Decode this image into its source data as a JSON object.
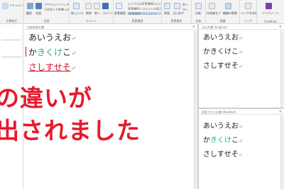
{
  "ribbon": {
    "groups": [
      {
        "label": "文章校正"
      },
      {
        "label": "言語"
      },
      {
        "label": "コメント"
      },
      {
        "label": "変更履歴"
      },
      {
        "label": "変更箇所"
      },
      {
        "label": "比較"
      },
      {
        "label": "保護"
      },
      {
        "label": "インク"
      },
      {
        "label": "OneNote"
      }
    ],
    "buttons": {
      "group1": "ドキュメント検査",
      "translate": "翻訳",
      "language": "言語",
      "new_comment": "新しいコメント",
      "delete": "削除",
      "comment_prev": "前へ",
      "comment_next": "次へ",
      "show_comments": "コメントの表示",
      "track_changes": "変更履歴の記録",
      "simple_markup": "シンプルな変更履歴/コメント",
      "show_markup": "変更履歴とコメントの表示",
      "reviewing_pane": "[変更履歴] ウィンドウ",
      "accept": "承諾",
      "reject": "元に戻す",
      "change_prev": "前へ",
      "change_next": "次へ",
      "compare": "比較",
      "block_authors": "作成者をブロック",
      "restrict_editing": "編集の制限",
      "hide_ink": "インクを非表示",
      "linked_notes": "リンクノート",
      "accessibility": "アクセシビリティチェック",
      "japanese_conversion": "日本語入力辞書への単語登録"
    }
  },
  "compared_pane": {
    "header": "比較結果文書",
    "lines": [
      {
        "text": "あいうえお",
        "mark": "↵"
      },
      {
        "pre": "か",
        "green": "きくけ",
        "post": "こ",
        "mark": "↵"
      },
      {
        "red": "さしすせそ",
        "mark": "↵"
      }
    ]
  },
  "original_pane": {
    "header": "元の文書 (Original)",
    "lines": [
      {
        "text": "あいうえお",
        "mark": "↵"
      },
      {
        "text": "かきくけこ",
        "mark": "↵"
      },
      {
        "text": "さしすせそ",
        "mark": "↵"
      }
    ]
  },
  "revised_pane": {
    "header": "変更された文書 (Modifed)",
    "lines": [
      {
        "text": "あいうえお",
        "mark": "↵"
      },
      {
        "pre": "か",
        "green": "きくけ",
        "post": "こ",
        "mark": "↵"
      },
      {
        "text": "さしすせそ",
        "mark": "↵"
      }
    ]
  },
  "overlay": {
    "line1": "の違いが",
    "line2": "出されました"
  },
  "colors": {
    "accent_red": "#e8192c",
    "insert_green": "#24b06a",
    "change_red": "#d0102a"
  }
}
